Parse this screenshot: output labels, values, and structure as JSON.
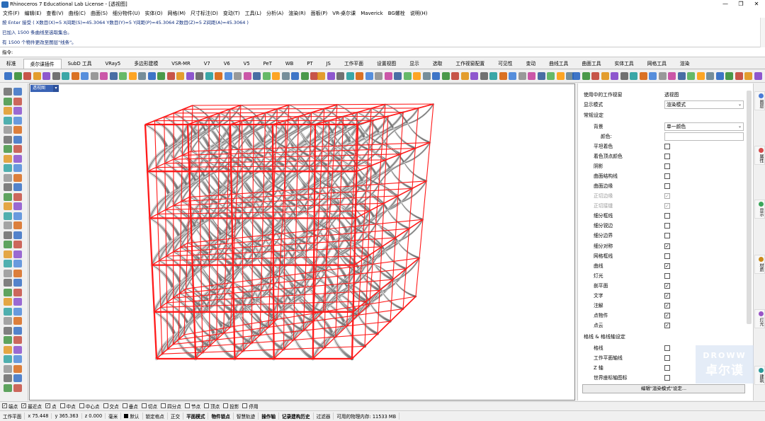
{
  "title": {
    "text": "Rhinoceros 7 Educational Lab License - [透视图]",
    "min": "—",
    "max": "❐",
    "close": "✕"
  },
  "menu": [
    "文件(F)",
    "编辑(E)",
    "查看(V)",
    "曲线(C)",
    "曲面(S)",
    "细分物件(U)",
    "实体(O)",
    "网格(M)",
    "尺寸标注(D)",
    "变动(T)",
    "工具(L)",
    "分析(A)",
    "渲染(R)",
    "面板(P)",
    "VR-桌尔课",
    "Maverick",
    "BG螺栓",
    "说明(H)"
  ],
  "command": {
    "history": [
      "按 Enter 接受 ( X数目(X)=5  X间距(S)=45.3064  Y数目(Y)=5  Y间距(P)=45.3064  Z数目(Z)=5  Z间距(A)=45.3064 )",
      "已加入 1500 条曲线至选取集合。",
      "有 1500 个物件更改至图层\"线条\"。"
    ],
    "prompt": "指令:"
  },
  "tabs": [
    "标准",
    "桌尔课插件",
    "SubD 工具",
    "VRay5",
    "多边形建模",
    "VSR-MR",
    "V7",
    "V6",
    "V5",
    "PeT",
    "WB",
    "PT",
    "JS",
    "工作平面",
    "设置视图",
    "显示",
    "选取",
    "工作视窗配置",
    "可见性",
    "变动",
    "曲线工具",
    "曲面工具",
    "实体工具",
    "网格工具",
    "渲染"
  ],
  "active_tab": "桌尔课插件",
  "viewport": {
    "label": "透视图",
    "dropdown": "▾"
  },
  "panel": {
    "viewport_in_use": {
      "label": "使用中的工作视窗",
      "value": "透视图"
    },
    "display_mode": {
      "label": "显示模式",
      "value": "渲染模式"
    },
    "section_general": "常规设定",
    "background": {
      "label": "背景",
      "value": "单一颜色"
    },
    "color": {
      "label": "颜色:"
    },
    "items": [
      {
        "label": "平坦着色",
        "checked": false,
        "disabled": false
      },
      {
        "label": "着色顶点颜色",
        "checked": false,
        "disabled": false
      },
      {
        "label": "阴影",
        "checked": false,
        "disabled": false
      },
      {
        "label": "曲面结构线",
        "checked": false,
        "disabled": false
      },
      {
        "label": "曲面边缘",
        "checked": false,
        "disabled": false
      },
      {
        "label": "正切边缘",
        "checked": true,
        "disabled": true
      },
      {
        "label": "正切接缝",
        "checked": true,
        "disabled": true
      },
      {
        "label": "细分框线",
        "checked": false,
        "disabled": false
      },
      {
        "label": "细分锐边",
        "checked": false,
        "disabled": false
      },
      {
        "label": "细分边界",
        "checked": false,
        "disabled": false
      },
      {
        "label": "细分对称",
        "checked": true,
        "disabled": false
      },
      {
        "label": "网格框线",
        "checked": false,
        "disabled": false
      },
      {
        "label": "曲线",
        "checked": true,
        "disabled": false
      },
      {
        "label": "灯光",
        "checked": false,
        "disabled": false
      },
      {
        "label": "剖平面",
        "checked": true,
        "disabled": false
      },
      {
        "label": "文字",
        "checked": true,
        "disabled": false
      },
      {
        "label": "注解",
        "checked": true,
        "disabled": false
      },
      {
        "label": "点物件",
        "checked": true,
        "disabled": false
      },
      {
        "label": "点云",
        "checked": true,
        "disabled": false
      }
    ],
    "section_grid": "格线 & 格线轴设定",
    "grid_items": [
      {
        "label": "格线",
        "checked": false
      },
      {
        "label": "工作平面轴线",
        "checked": false
      },
      {
        "label": "Z 轴",
        "checked": false
      },
      {
        "label": "世界座标轴图标",
        "checked": false
      }
    ],
    "edit_button": "编辑\"渲染模式\"设定..."
  },
  "siderail": [
    "图层",
    "属性",
    "显示",
    "材质",
    "灯光",
    "建筑"
  ],
  "osnaps": [
    {
      "label": "端点",
      "checked": true
    },
    {
      "label": "最近点",
      "checked": true
    },
    {
      "label": "点",
      "checked": true
    },
    {
      "label": "中点",
      "checked": false
    },
    {
      "label": "中心点",
      "checked": false
    },
    {
      "label": "交点",
      "checked": false
    },
    {
      "label": "垂点",
      "checked": false
    },
    {
      "label": "切点",
      "checked": false
    },
    {
      "label": "四分点",
      "checked": false
    },
    {
      "label": "节点",
      "checked": false
    },
    {
      "label": "顶点",
      "checked": false
    },
    {
      "label": "投影",
      "checked": false
    },
    {
      "label": "停用",
      "checked": false
    }
  ],
  "status": {
    "cplane": "工作平面",
    "x": "x 75.448",
    "y": "y 365.363",
    "z": "z 0.000",
    "unit": "毫米",
    "layer": "默认",
    "toggles": [
      "锁定格点",
      "正交",
      "平面模式",
      "物件锁点",
      "智慧轨迹",
      "操作轴",
      "记录建构历史",
      "过滤器"
    ],
    "bold_toggles": [
      "平面模式",
      "物件锁点",
      "操作轴",
      "记录建构历史"
    ],
    "memory": "可用的物理内存: 11533 MB"
  },
  "watermark": {
    "line1": "DROWW",
    "line2": "卓尔谟"
  },
  "colors": {
    "frame": "#ff1a1a",
    "viewport_tab": "#3a63b5",
    "lattice": "#d6d6d6"
  }
}
